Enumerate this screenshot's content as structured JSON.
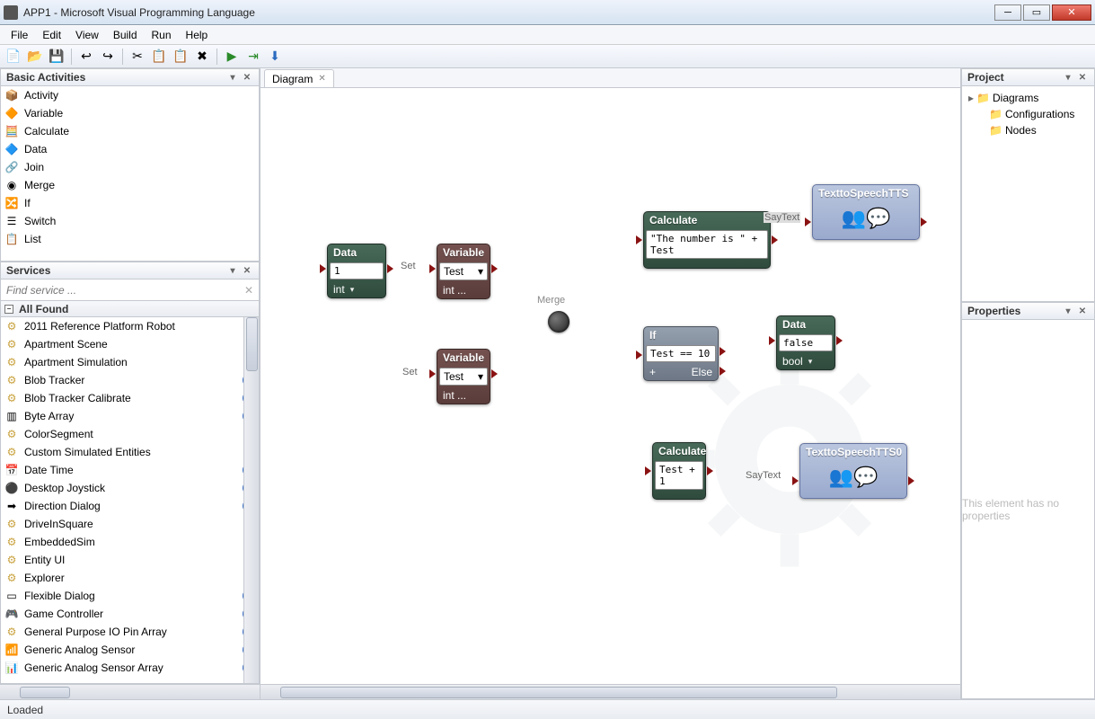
{
  "titlebar": {
    "title": "APP1 - Microsoft Visual Programming Language"
  },
  "menu": {
    "items": [
      "File",
      "Edit",
      "View",
      "Build",
      "Run",
      "Help"
    ]
  },
  "toolbar_icons": [
    "📄",
    "📂",
    "💾",
    "↩",
    "↪",
    "✂",
    "📋",
    "📋",
    "✖",
    "▶",
    "⇥",
    "⬇"
  ],
  "panels": {
    "activities_title": "Basic Activities",
    "services_title": "Services",
    "project_title": "Project",
    "properties_title": "Properties",
    "properties_msg": "This element has no properties"
  },
  "activities": [
    {
      "label": "Activity",
      "icon": "📦"
    },
    {
      "label": "Variable",
      "icon": "🔶"
    },
    {
      "label": "Calculate",
      "icon": "🧮"
    },
    {
      "label": "Data",
      "icon": "🔷"
    },
    {
      "label": "Join",
      "icon": "🔗"
    },
    {
      "label": "Merge",
      "icon": "◉"
    },
    {
      "label": "If",
      "icon": "🔀"
    },
    {
      "label": "Switch",
      "icon": "☰"
    },
    {
      "label": "List",
      "icon": "📋"
    }
  ],
  "services": {
    "search_placeholder": "Find service ...",
    "allfound": "All Found",
    "items": [
      {
        "label": "2011 Reference Platform Robot",
        "icon": "gear",
        "info": false
      },
      {
        "label": "Apartment Scene",
        "icon": "gear",
        "info": false
      },
      {
        "label": "Apartment Simulation",
        "icon": "gear",
        "info": false
      },
      {
        "label": "Blob Tracker",
        "icon": "gear",
        "info": true
      },
      {
        "label": "Blob Tracker Calibrate",
        "icon": "gear",
        "info": true
      },
      {
        "label": "Byte Array",
        "icon": "bars",
        "info": true
      },
      {
        "label": "ColorSegment",
        "icon": "gear",
        "info": false
      },
      {
        "label": "Custom Simulated Entities",
        "icon": "gear",
        "info": false
      },
      {
        "label": "Date Time",
        "icon": "cal",
        "info": true
      },
      {
        "label": "Desktop Joystick",
        "icon": "ball",
        "info": true
      },
      {
        "label": "Direction Dialog",
        "icon": "dir",
        "info": true
      },
      {
        "label": "DriveInSquare",
        "icon": "gear",
        "info": false
      },
      {
        "label": "EmbeddedSim",
        "icon": "gear",
        "info": false
      },
      {
        "label": "Entity UI",
        "icon": "gear",
        "info": false
      },
      {
        "label": "Explorer",
        "icon": "gear",
        "info": false
      },
      {
        "label": "Flexible Dialog",
        "icon": "dlg",
        "info": true
      },
      {
        "label": "Game Controller",
        "icon": "game",
        "info": true
      },
      {
        "label": "General Purpose IO Pin Array",
        "icon": "gear",
        "info": true
      },
      {
        "label": "Generic Analog Sensor",
        "icon": "blue",
        "info": true
      },
      {
        "label": "Generic Analog Sensor Array",
        "icon": "blue2",
        "info": true
      }
    ]
  },
  "tab": {
    "title": "Diagram"
  },
  "project": {
    "items": [
      {
        "label": "Diagrams",
        "expandable": true
      },
      {
        "label": "Configurations",
        "expandable": false
      },
      {
        "label": "Nodes",
        "expandable": false
      }
    ]
  },
  "nodes": {
    "data1": {
      "title": "Data",
      "value": "1",
      "type": "int"
    },
    "var1": {
      "title": "Variable",
      "value": "Test",
      "type": "int    ..."
    },
    "var2": {
      "title": "Variable",
      "value": "Test",
      "type": "int    ..."
    },
    "merge": {
      "title": "Merge"
    },
    "calc1": {
      "title": "Calculate",
      "expr": "\"The number is \" + Test"
    },
    "if": {
      "title": "If",
      "cond": "Test == 10",
      "plus": "+",
      "else": "Else"
    },
    "data2": {
      "title": "Data",
      "value": "false",
      "type": "bool"
    },
    "calc2": {
      "title": "Calculate",
      "expr": "Test + 1"
    },
    "tts1": {
      "title": "TexttoSpeechTTS"
    },
    "tts2": {
      "title": "TexttoSpeechTTS0"
    }
  },
  "conn": {
    "set1": "Set",
    "set2": "Set",
    "say1": "SayText",
    "say2": "SayText"
  },
  "status": "Loaded"
}
